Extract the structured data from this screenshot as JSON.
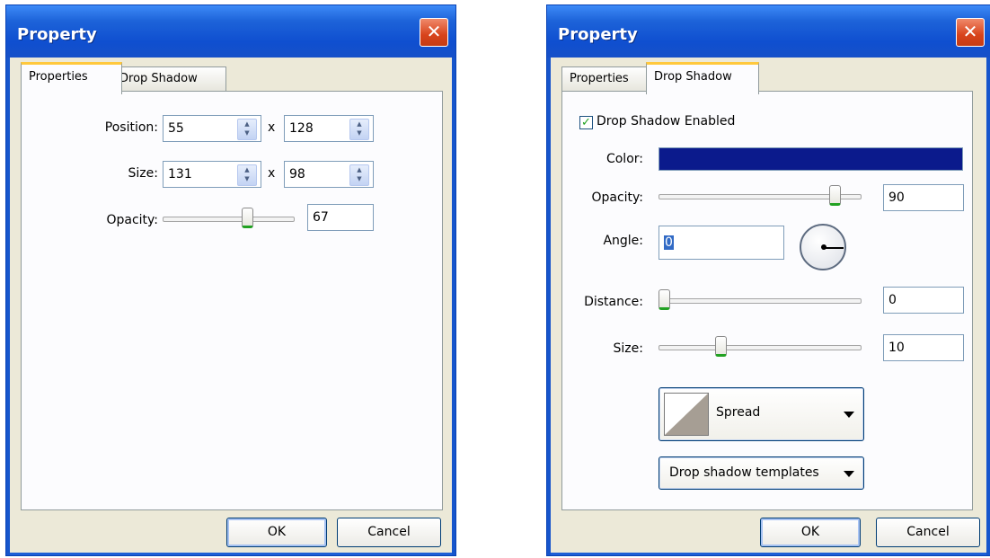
{
  "dialog1": {
    "title": "Property",
    "close_glyph": "✕",
    "tabs": [
      "Properties",
      "Drop Shadow"
    ],
    "active_tab": "Properties",
    "position": {
      "label": "Position:",
      "x": "55",
      "sep": "x",
      "y": "128"
    },
    "size": {
      "label": "Size:",
      "w": "131",
      "sep": "x",
      "h": "98"
    },
    "opacity": {
      "label": "Opacity:",
      "value": "67",
      "level": 0.67
    },
    "ok_label": "OK",
    "cancel_label": "Cancel"
  },
  "dialog2": {
    "title": "Property",
    "close_glyph": "✕",
    "tabs": [
      "Properties",
      "Drop Shadow"
    ],
    "active_tab": "Drop Shadow",
    "enabled": {
      "label": "Drop Shadow Enabled",
      "checked": true,
      "check_glyph": "✓"
    },
    "color": {
      "label": "Color:",
      "value": "#0b1a8c"
    },
    "opacity": {
      "label": "Opacity:",
      "value": "90",
      "level": 0.9
    },
    "angle": {
      "label": "Angle:",
      "value": "0"
    },
    "distance": {
      "label": "Distance:",
      "value": "0",
      "level": 0.0
    },
    "size": {
      "label": "Size:",
      "value": "10",
      "level": 0.3
    },
    "spread_label": "Spread",
    "templates_label": "Drop shadow templates",
    "ok_label": "OK",
    "cancel_label": "Cancel"
  },
  "colors": {
    "title_bar": "#1d63d9",
    "close_button": "#d8431b",
    "dialog_face": "#ece9d8",
    "active_tab_highlight": "#ffc83c",
    "slider_thumb_accent": "#21a121"
  },
  "icons": [
    "close-icon",
    "spin-up-icon",
    "spin-down-icon",
    "checkbox-check-icon",
    "dropdown-arrow-icon",
    "angle-dial-icon"
  ]
}
